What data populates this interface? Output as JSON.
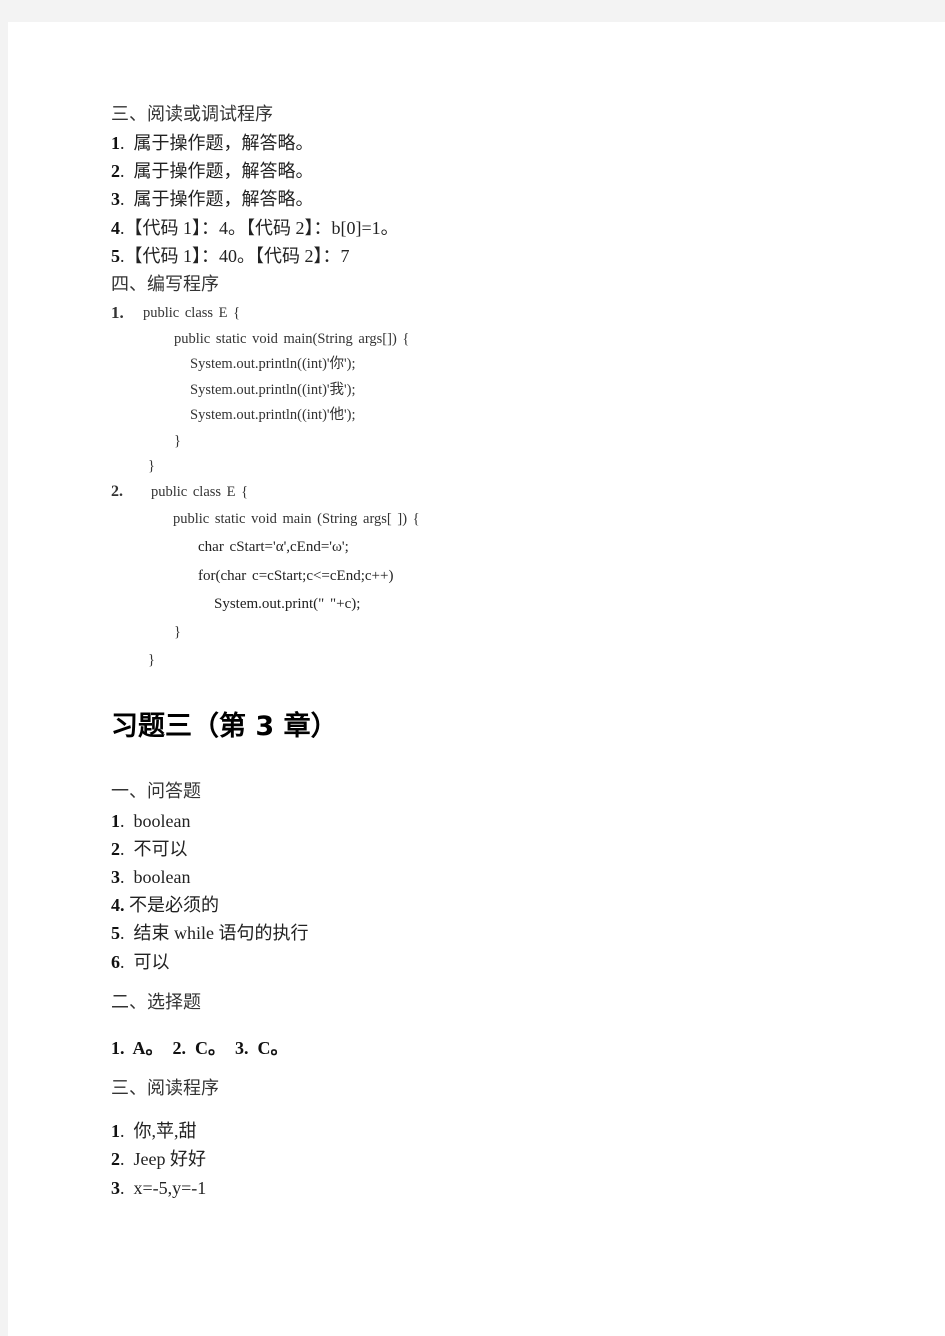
{
  "section3": {
    "title": "三、阅读或调试程序",
    "items": [
      {
        "num": "1",
        "text": "属于操作题，解答略。"
      },
      {
        "num": "2",
        "text": "属于操作题，解答略。"
      },
      {
        "num": "3",
        "text": "属于操作题，解答略。"
      },
      {
        "num": "4",
        "text": "【代码 1】：4。【代码 2】：b[0]=1。"
      },
      {
        "num": "5",
        "text": "【代码 1】：40。【代码 2】：7"
      }
    ]
  },
  "section4": {
    "title": "四、编写程序",
    "program1": {
      "num": "1.",
      "lines": [
        "public class E {",
        "public static void main(String args[]) {",
        "System.out.println((int)'你');",
        "System.out.println((int)'我');",
        "System.out.println((int)'他');",
        "}",
        "}"
      ]
    },
    "program2": {
      "num": "2.",
      "lines": [
        "public class E {",
        "public static void main (String args[ ]) {",
        "char cStart='α',cEnd='ω';",
        "for(char c=cStart;c<=cEnd;c++)",
        "System.out.print(\" \"+c);",
        "}",
        "}"
      ]
    }
  },
  "chapter": {
    "heading": "习题三（第 3 章）",
    "qa": {
      "title": "一、问答题",
      "items": [
        {
          "num": "1",
          "text": "boolean"
        },
        {
          "num": "2",
          "text": "不可以"
        },
        {
          "num": "3",
          "text": "boolean"
        },
        {
          "num": "4",
          "text": "不是必须的"
        },
        {
          "num": "5",
          "text": "结束 while 语句的执行"
        },
        {
          "num": "6",
          "text": "可以"
        }
      ]
    },
    "choice": {
      "title": "二、选择题",
      "answers": [
        {
          "num": "1",
          "answer": "A。"
        },
        {
          "num": "2",
          "answer": "C。"
        },
        {
          "num": "3",
          "answer": "C。"
        }
      ]
    },
    "reading": {
      "title": "三、阅读程序",
      "items": [
        {
          "num": "1",
          "text": "你,苹,甜"
        },
        {
          "num": "2",
          "text": "Jeep 好好"
        },
        {
          "num": "3",
          "text": "x=-5,y=-1"
        }
      ]
    }
  }
}
